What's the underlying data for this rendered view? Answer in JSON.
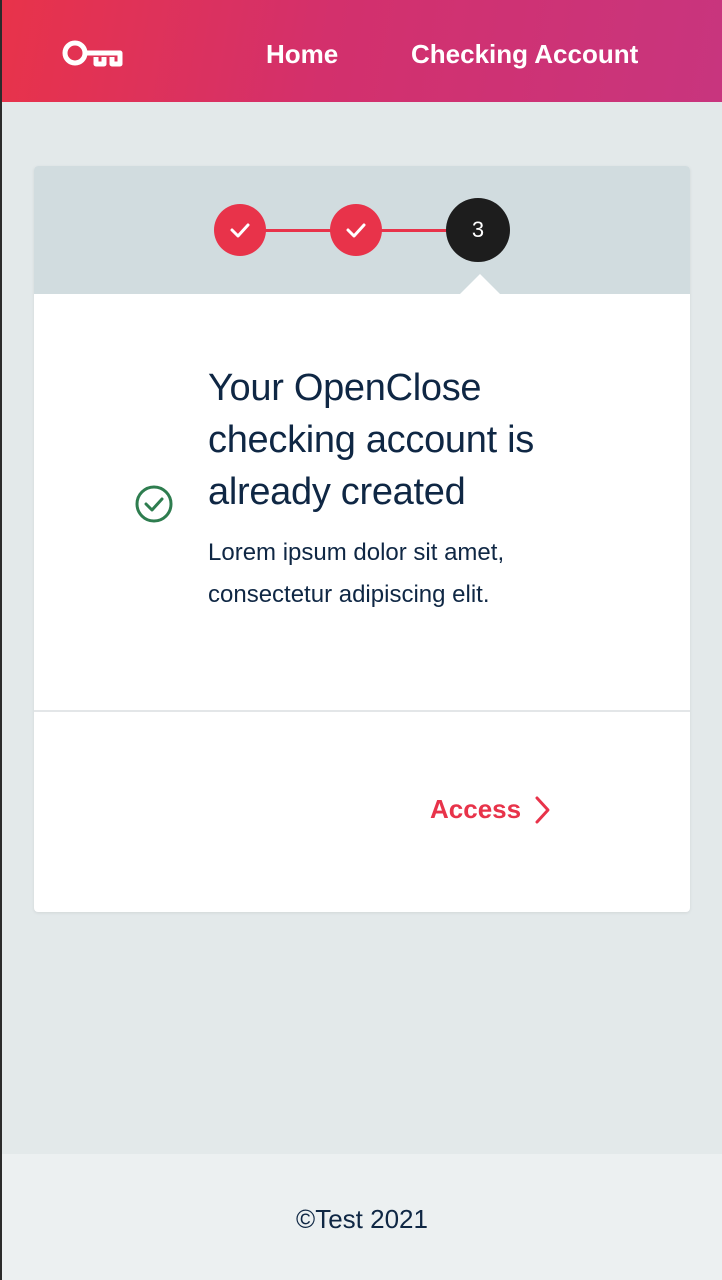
{
  "header": {
    "logo_icon": "openclose-key-logo-icon",
    "nav": {
      "home_label": "Home",
      "account_label": "Checking Account"
    },
    "gradient": [
      "#e8334a",
      "#c8357e"
    ]
  },
  "stepper": {
    "steps": [
      {
        "status": "completed",
        "icon": "check-icon"
      },
      {
        "status": "completed",
        "icon": "check-icon"
      },
      {
        "status": "current",
        "label": "3"
      }
    ],
    "accent_color": "#e8334a",
    "current_color": "#1d1d1d"
  },
  "content": {
    "status_icon": "check-circle-icon",
    "status_color": "#2e7d4f",
    "title": "Your OpenClose checking account is already created",
    "description": "Lorem ipsum dolor sit amet, consectetur adipiscing elit."
  },
  "actions": {
    "access_label": "Access",
    "access_icon": "chevron-right-icon"
  },
  "footer": {
    "copyright": "©Test 2021"
  }
}
